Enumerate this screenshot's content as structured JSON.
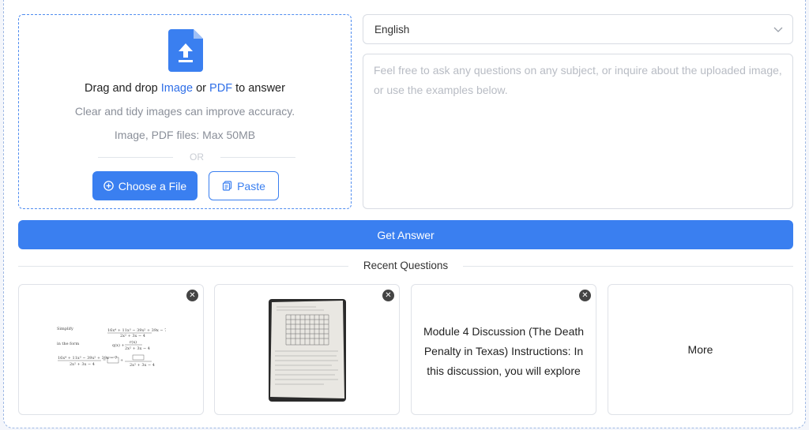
{
  "upload": {
    "drag_prefix": "Drag and drop",
    "image_link": "Image",
    "or_word": "or",
    "pdf_link": "PDF",
    "drag_suffix": "to answer",
    "hint": "Clear and tidy images can improve accuracy.",
    "limits": "Image, PDF files: Max 50MB",
    "divider": "OR",
    "choose_label": "Choose a File",
    "paste_label": "Paste"
  },
  "language": {
    "selected": "English"
  },
  "question": {
    "placeholder": "Feel free to ask any questions on any subject, or inquire about the uploaded image, or use the examples below."
  },
  "actions": {
    "get_answer": "Get Answer"
  },
  "recent": {
    "title": "Recent Questions",
    "cards": [
      {
        "kind": "image",
        "thumbnail": "math-equation-image"
      },
      {
        "kind": "image",
        "thumbnail": "graph-worksheet-photo"
      },
      {
        "kind": "text",
        "text": "Module 4 Discussion (The Death Penalty in Texas) Instructions: In this discussion, you will explore"
      }
    ],
    "more_label": "More"
  },
  "colors": {
    "accent": "#3a7ff0",
    "border": "#d8dce3"
  }
}
